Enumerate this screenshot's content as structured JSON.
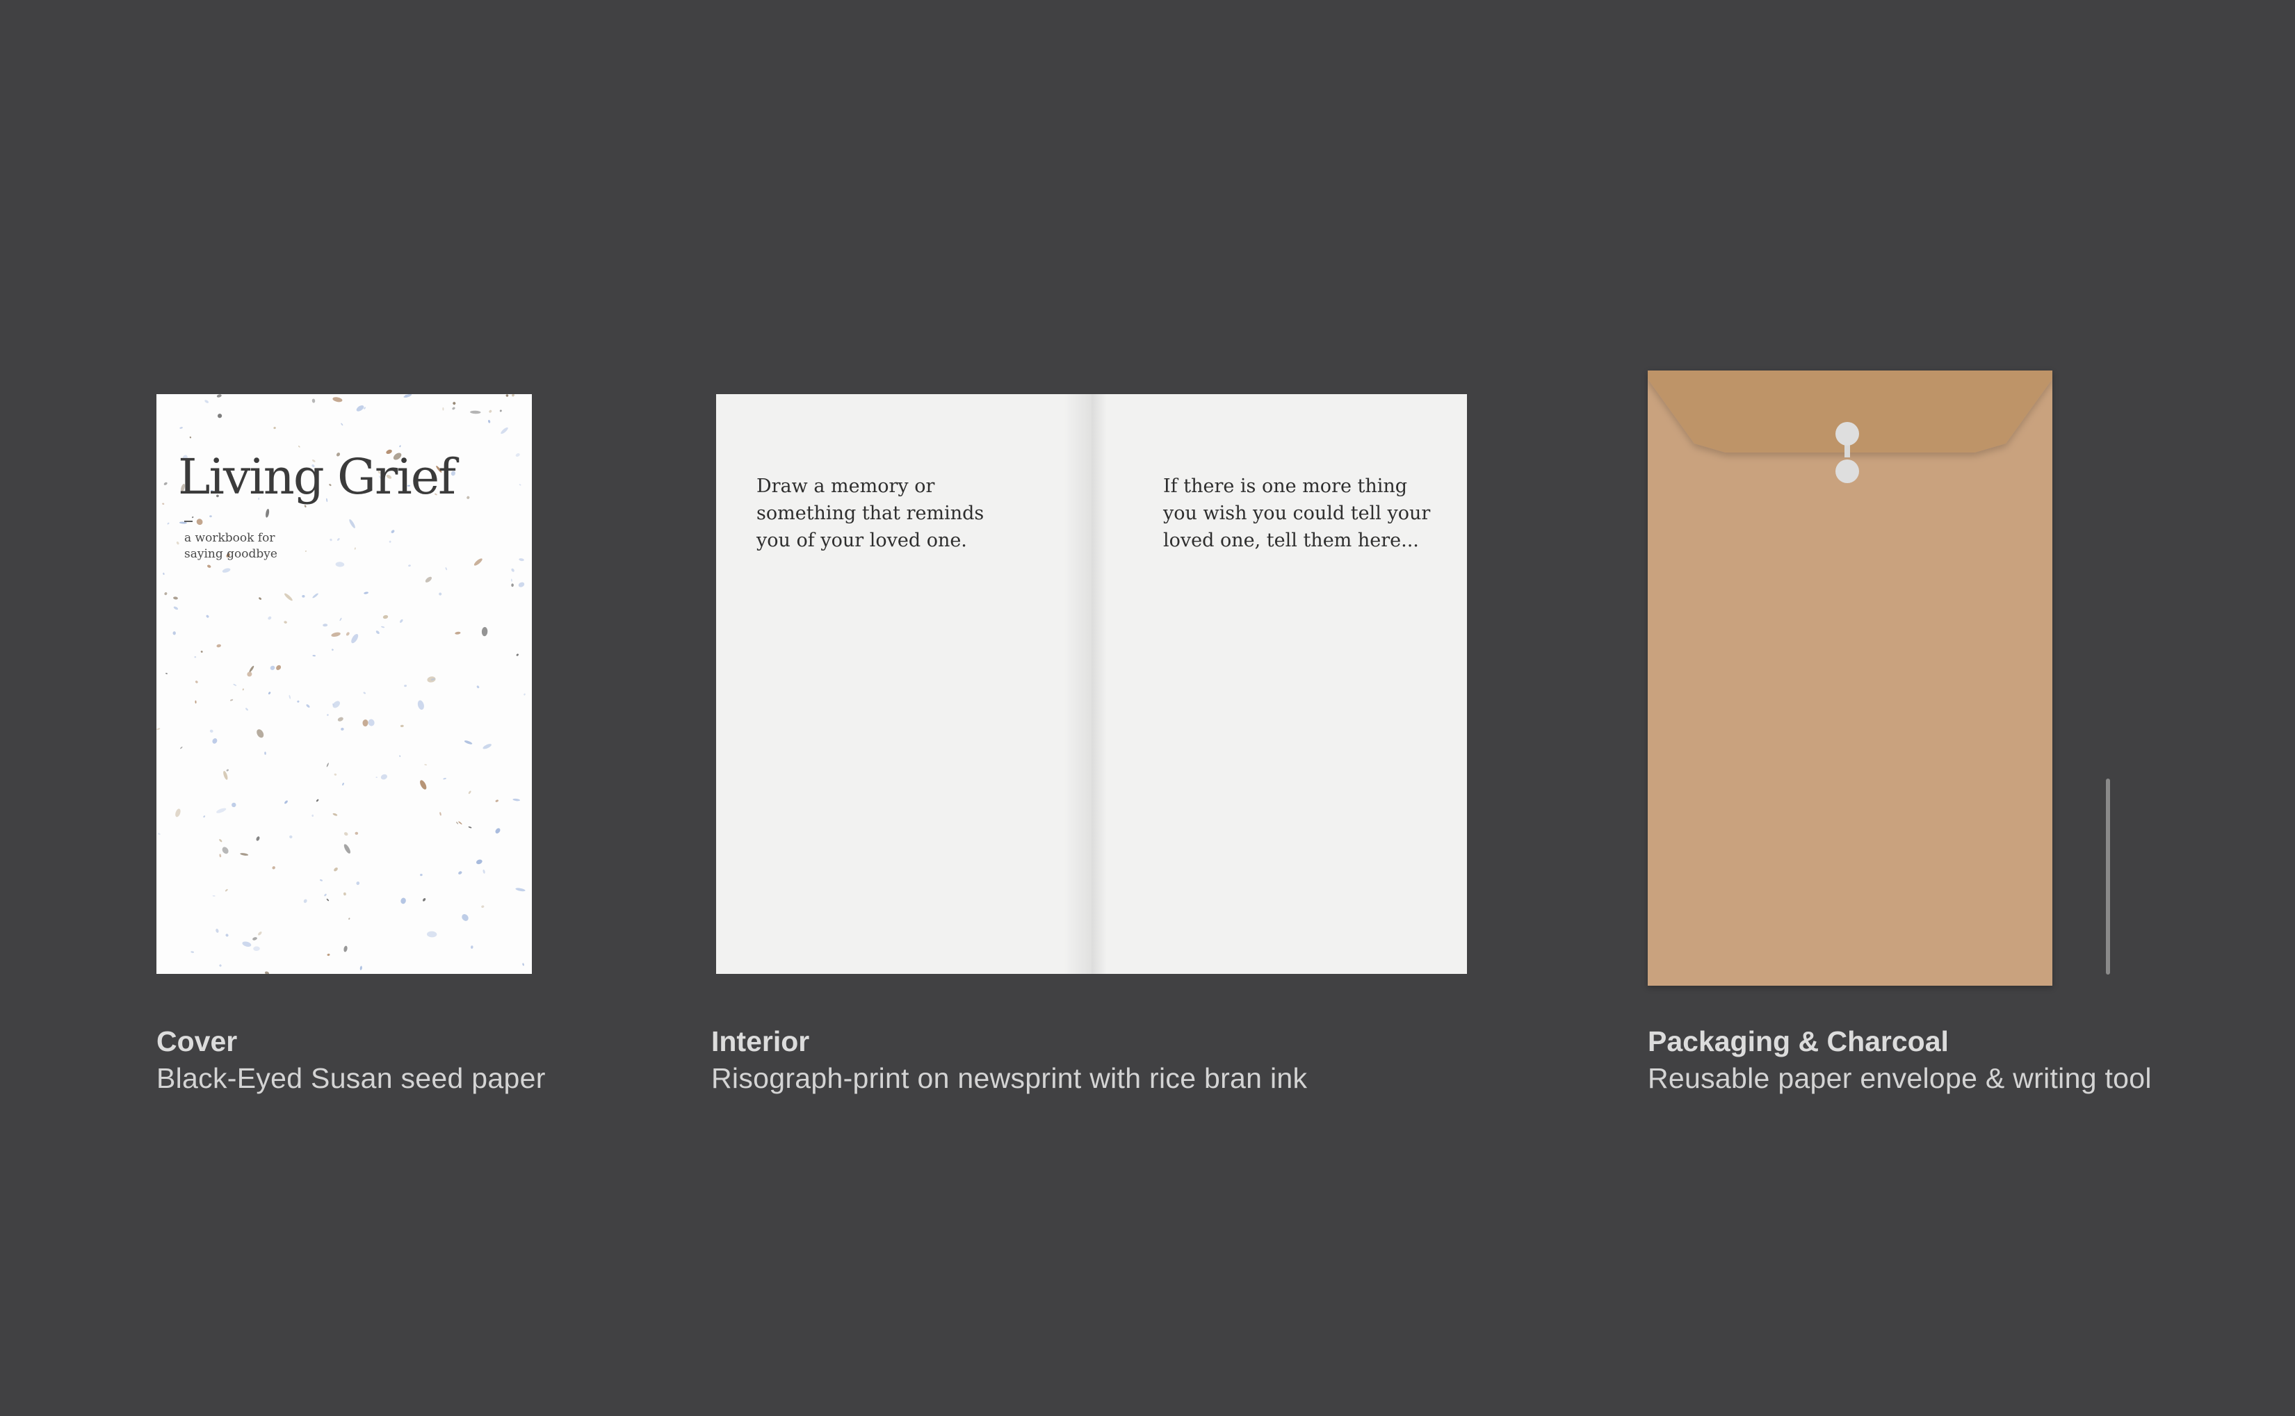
{
  "cover": {
    "title": "Living Grief",
    "subtitle_line1": "a workbook for",
    "subtitle_line2": "saying goodbye"
  },
  "interior": {
    "left_prompt": "Draw a memory or\nsomething that reminds\nyou of your loved one.",
    "right_prompt": "If there is one more thing\nyou wish you could tell your\nloved one, tell them here..."
  },
  "captions": [
    {
      "title": "Cover",
      "description": "Black-Eyed Susan seed paper"
    },
    {
      "title": "Interior",
      "description": "Risograph-print on newsprint with rice bran ink"
    },
    {
      "title": "Packaging & Charcoal",
      "description": "Reusable paper envelope & writing tool"
    }
  ],
  "colors": {
    "background": "#414143",
    "envelope": "#c9a27e",
    "envelope_flap": "#be9468",
    "paper": "#f2f2f1",
    "caption_text": "#d4d4d4"
  }
}
